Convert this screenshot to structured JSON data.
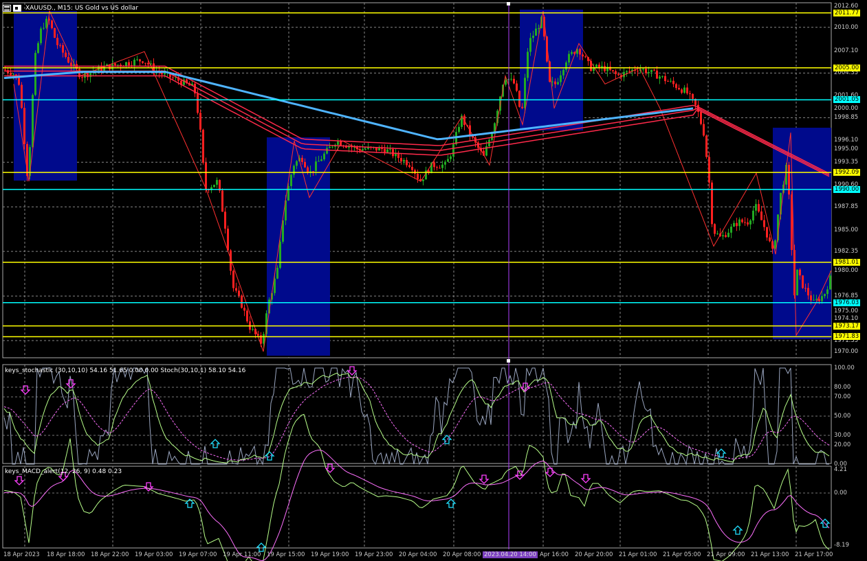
{
  "window": {
    "title": "XAUUSD., M15:  US Gold vs US dollar"
  },
  "subwindows": {
    "stoch_title": "keys_stochastic (30,10,10) 54.16 51.65 0.00 0.00 Stoch(30,10,1) 58.10 54.16",
    "macd_title": "keys_MACD_alert(12, 26, 9) 0.48 0.23"
  },
  "price_axis": {
    "plain_labels": [
      "2012.60",
      "2010.00",
      "2007.10",
      "2004.35",
      "2001.60",
      "2000.00",
      "1998.85",
      "1996.10",
      "1995.00",
      "1993.35",
      "1990.60",
      "1987.85",
      "1985.00",
      "1982.35",
      "1980.00",
      "1976.85",
      "1975.00",
      "1974.10",
      "1971.35",
      "1970.00"
    ]
  },
  "level_labels": [
    {
      "text": "2011.77",
      "color": "#ffff00"
    },
    {
      "text": "2005.00",
      "color": "#ffff00"
    },
    {
      "text": "2001.05",
      "color": "#00ffff"
    },
    {
      "text": "1992.09",
      "color": "#ffff00"
    },
    {
      "text": "1990.00",
      "color": "#00ffff"
    },
    {
      "text": "1981.01",
      "color": "#ffff00"
    },
    {
      "text": "1976.03",
      "color": "#00ffff"
    },
    {
      "text": "1973.17",
      "color": "#ffff00"
    },
    {
      "text": "1971.83",
      "color": "#ffff00"
    }
  ],
  "stoch_axis": [
    "100.00",
    "80.00",
    "70.00",
    "50.00",
    "30.00",
    "20.00",
    "0.00"
  ],
  "macd_axis": [
    "4.21",
    "0.00",
    "-8.19"
  ],
  "time_axis": [
    "18 Apr 2023",
    "18 Apr 18:00",
    "18 Apr 22:00",
    "19 Apr 03:00",
    "19 Apr 07:00",
    "19 Apr 11:00",
    "19 Apr 15:00",
    "19 Apr 19:00",
    "19 Apr 23:00",
    "20 Apr 04:00",
    "20 Apr 08:00",
    "2023.04.20 14:00",
    "Apr 16:00",
    "20 Apr 20:00",
    "21 Apr 01:00",
    "21 Apr 05:00",
    "21 Apr 09:00",
    "21 Apr 13:00",
    "21 Apr 17:00"
  ],
  "colors": {
    "background": "#000000",
    "bull_candle": "#22aa22",
    "bear_candle": "#ff2020",
    "level_yellow": "#ffff00",
    "level_cyan": "#00ffff",
    "zone_fill": "#000a8c",
    "crosshair": "#b040ff",
    "ma_red": "#ff2a4a",
    "ma_blue": "#4fb4ff",
    "arrow_down": "#ff40ff",
    "arrow_up": "#20e0ff"
  }
}
